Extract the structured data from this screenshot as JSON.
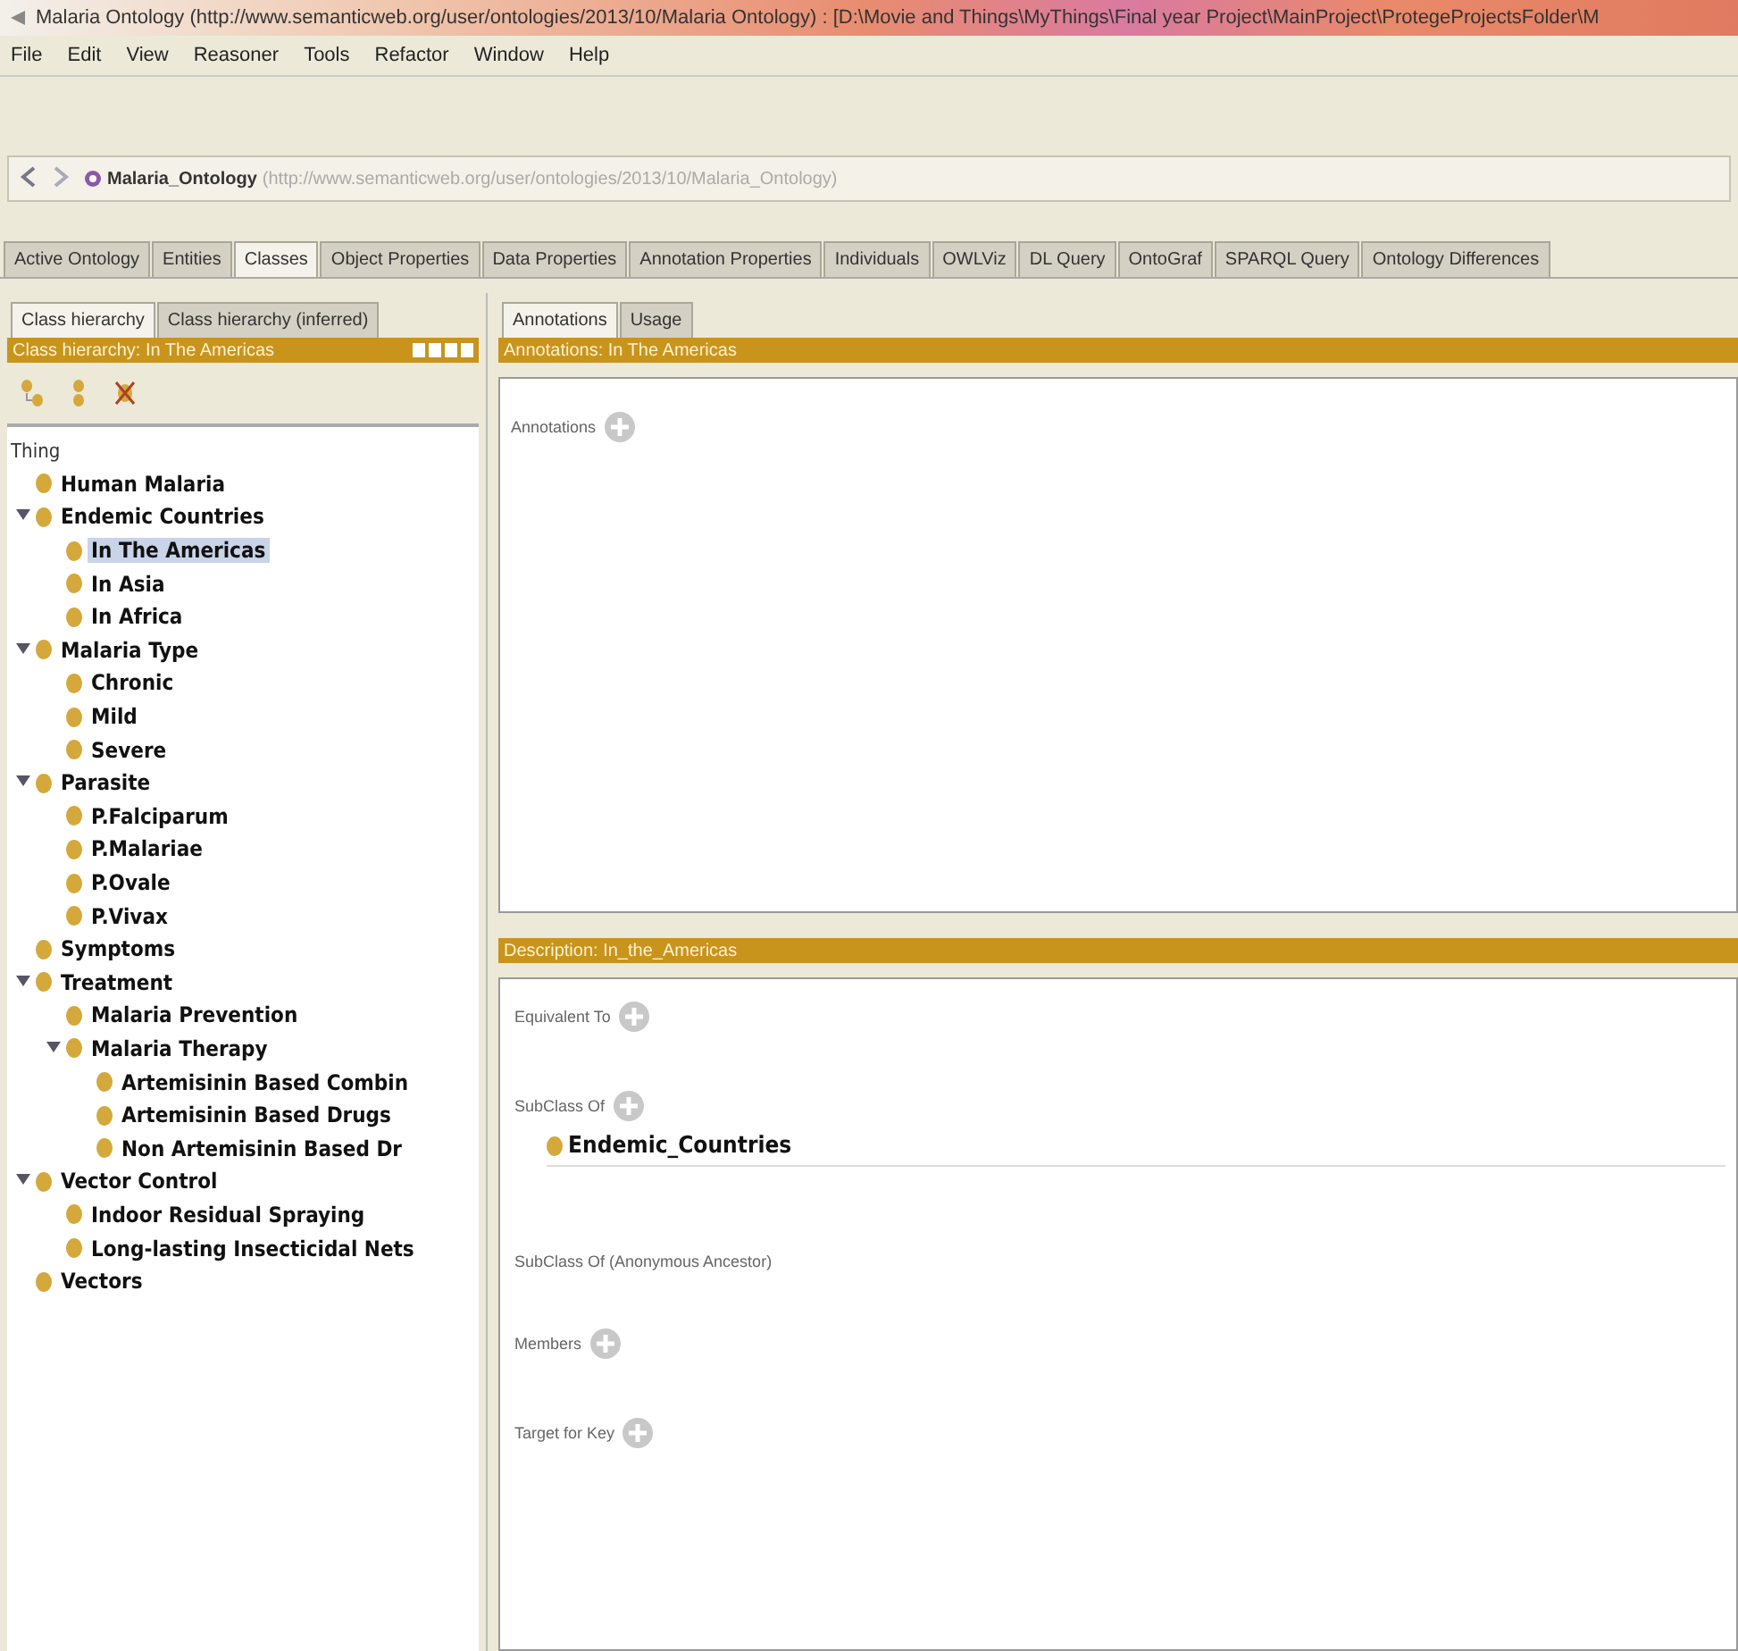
{
  "window": {
    "title": "Malaria Ontology (http://www.semanticweb.org/user/ontologies/2013/10/Malaria Ontology) : [D:\\Movie and Things\\MyThings\\Final year Project\\MainProject\\ProtegeProjectsFolder\\M"
  },
  "menu": [
    "File",
    "Edit",
    "View",
    "Reasoner",
    "Tools",
    "Refactor",
    "Window",
    "Help"
  ],
  "address": {
    "name": "Malaria_Ontology",
    "iri": "(http://www.semanticweb.org/user/ontologies/2013/10/Malaria_Ontology)"
  },
  "tabs": [
    {
      "label": "Active Ontology",
      "selected": false
    },
    {
      "label": "Entities",
      "selected": false
    },
    {
      "label": "Classes",
      "selected": true
    },
    {
      "label": "Object Properties",
      "selected": false
    },
    {
      "label": "Data Properties",
      "selected": false
    },
    {
      "label": "Annotation Properties",
      "selected": false
    },
    {
      "label": "Individuals",
      "selected": false
    },
    {
      "label": "OWLViz",
      "selected": false
    },
    {
      "label": "DL Query",
      "selected": false
    },
    {
      "label": "OntoGraf",
      "selected": false
    },
    {
      "label": "SPARQL Query",
      "selected": false
    },
    {
      "label": "Ontology Differences",
      "selected": false
    }
  ],
  "left_panel": {
    "tabs": [
      {
        "label": "Class hierarchy",
        "selected": true
      },
      {
        "label": "Class hierarchy (inferred)",
        "selected": false
      }
    ],
    "header": "Class hierarchy: In The Americas",
    "root": "Thing",
    "tree": [
      {
        "label": "Human Malaria",
        "selected": false
      },
      {
        "label": "Endemic Countries",
        "selected": false,
        "expanded": true,
        "children": [
          {
            "label": "In The Americas",
            "selected": true
          },
          {
            "label": "In Asia",
            "selected": false
          },
          {
            "label": "In Africa",
            "selected": false
          }
        ]
      },
      {
        "label": "Malaria Type",
        "selected": false,
        "expanded": true,
        "children": [
          {
            "label": "Chronic",
            "selected": false
          },
          {
            "label": "Mild",
            "selected": false
          },
          {
            "label": "Severe",
            "selected": false
          }
        ]
      },
      {
        "label": "Parasite",
        "selected": false,
        "expanded": true,
        "children": [
          {
            "label": "P.Falciparum",
            "selected": false
          },
          {
            "label": "P.Malariae",
            "selected": false
          },
          {
            "label": "P.Ovale",
            "selected": false
          },
          {
            "label": "P.Vivax",
            "selected": false
          }
        ]
      },
      {
        "label": "Symptoms",
        "selected": false
      },
      {
        "label": "Treatment",
        "selected": false,
        "expanded": true,
        "children": [
          {
            "label": "Malaria Prevention",
            "selected": false
          },
          {
            "label": "Malaria Therapy",
            "selected": false,
            "expanded": true,
            "children": [
              {
                "label": "Artemisinin Based Combin",
                "selected": false
              },
              {
                "label": "Artemisinin Based Drugs",
                "selected": false
              },
              {
                "label": "Non Artemisinin Based Dr",
                "selected": false
              }
            ]
          }
        ]
      },
      {
        "label": "Vector Control",
        "selected": false,
        "expanded": true,
        "children": [
          {
            "label": "Indoor Residual Spraying",
            "selected": false
          },
          {
            "label": "Long-lasting Insecticidal Nets",
            "selected": false
          }
        ]
      },
      {
        "label": "Vectors",
        "selected": false
      }
    ]
  },
  "right_panel": {
    "tabs": [
      {
        "label": "Annotations",
        "selected": true
      },
      {
        "label": "Usage",
        "selected": false
      }
    ],
    "annotations_header": "Annotations: In The Americas",
    "annotations_label": "Annotations",
    "description_header": "Description: In_the_Americas",
    "sections": [
      {
        "label": "Equivalent To",
        "addable": true
      },
      {
        "label": "SubClass Of",
        "addable": true,
        "items": [
          "Endemic_Countries"
        ]
      },
      {
        "label": "SubClass Of (Anonymous Ancestor)",
        "addable": false
      },
      {
        "label": "Members",
        "addable": true
      },
      {
        "label": "Target for Key",
        "addable": true
      }
    ]
  }
}
